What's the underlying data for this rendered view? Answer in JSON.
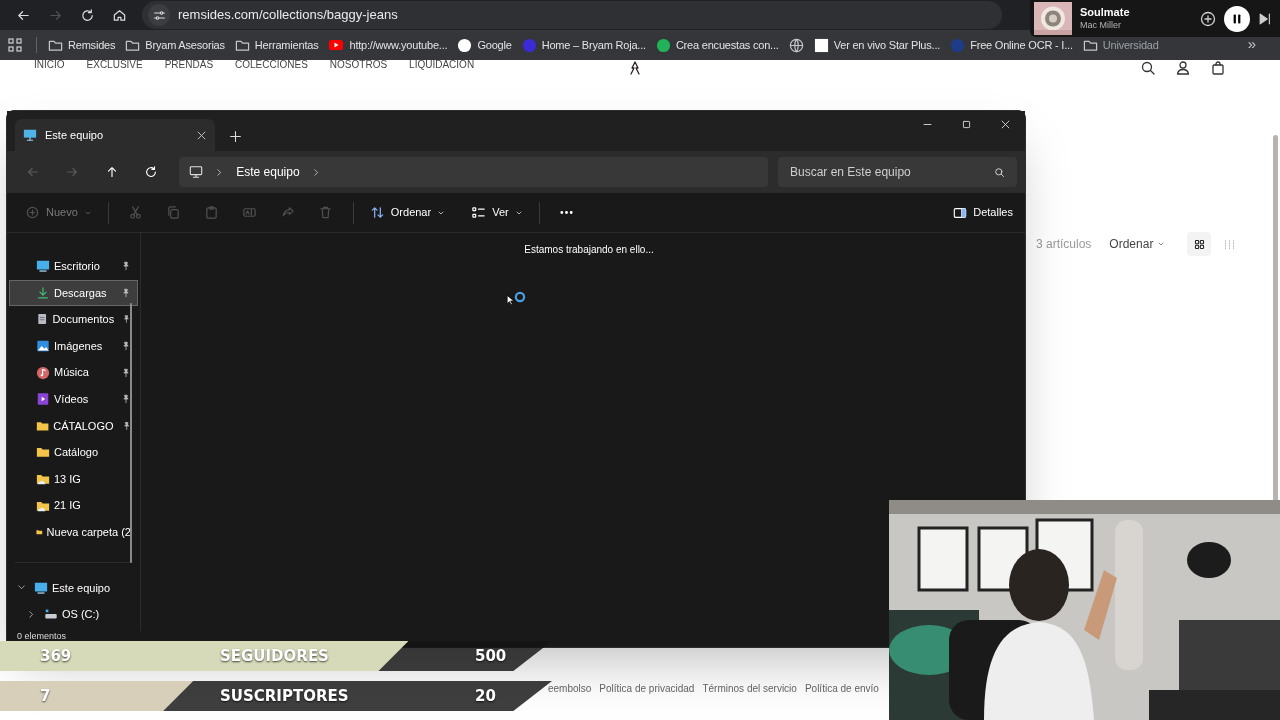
{
  "browser": {
    "address": "remsides.com/collections/baggy-jeans",
    "nav_buttons": [
      {
        "kind": "back",
        "disabled": false
      },
      {
        "kind": "forward",
        "disabled": true
      },
      {
        "kind": "reload",
        "disabled": false
      },
      {
        "kind": "home",
        "disabled": false
      }
    ],
    "bookmarks": [
      {
        "kind": "folder",
        "label": "Remsides"
      },
      {
        "kind": "folder",
        "label": "Bryam Asesorias"
      },
      {
        "kind": "folder",
        "label": "Herramientas"
      },
      {
        "kind": "video",
        "label": "http://www.youtube...",
        "color": "#ff0000"
      },
      {
        "kind": "site",
        "label": "Google",
        "color": "#ffffff"
      },
      {
        "kind": "site",
        "label": "Home – Bryam Roja...",
        "color": "#3b2bd6"
      },
      {
        "kind": "site",
        "label": "Crea encuestas con...",
        "color": "#22b35a"
      },
      {
        "kind": "globe"
      },
      {
        "kind": "page",
        "label": "Ver en vivo Star Plus..."
      },
      {
        "kind": "site",
        "label": "Free Online OCR - I...",
        "color": "#1f3c88"
      },
      {
        "kind": "folder",
        "label": "Universidad"
      }
    ],
    "more": "»"
  },
  "now_playing": {
    "title": "Soulmate",
    "artist": "Mac Miller",
    "playing": true
  },
  "website": {
    "nav": [
      "INICIO",
      "EXCLUSIVE",
      "PRENDAS",
      "COLECCIONES",
      "NOSOTROS",
      "LIQUIDACION"
    ],
    "product_count": "3 artículos",
    "sort": "Ordenar",
    "layouts": [
      {
        "kind": "large",
        "selected": true
      },
      {
        "kind": "small",
        "selected": false
      }
    ],
    "footer_links": [
      "eembolso",
      "Política de privacidad",
      "Términos del servicio",
      "Política de envío"
    ]
  },
  "explorer": {
    "tab": "Este equipo",
    "breadcrumb": "Este equipo",
    "search_placeholder": "Buscar en Este equipo",
    "nav_buttons": [
      {
        "kind": "back",
        "disabled": true
      },
      {
        "kind": "forward",
        "disabled": true
      },
      {
        "kind": "up",
        "disabled": false
      },
      {
        "kind": "refresh",
        "disabled": false
      }
    ],
    "toolbar": [
      {
        "kind": "new",
        "label": "Nuevo",
        "disabled": true
      },
      {
        "kind": "cut",
        "disabled": true
      },
      {
        "kind": "copy",
        "disabled": true
      },
      {
        "kind": "paste",
        "disabled": true
      },
      {
        "kind": "rename",
        "disabled": true
      },
      {
        "kind": "share",
        "disabled": true
      },
      {
        "kind": "delete",
        "disabled": true
      },
      {
        "kind": "sort",
        "label": "Ordenar",
        "disabled": false
      },
      {
        "kind": "view",
        "label": "Ver",
        "disabled": false
      },
      {
        "kind": "more",
        "disabled": false
      }
    ],
    "details": "Detalles",
    "quick_access": [
      {
        "label": "Escritorio",
        "kind": "desktop",
        "pinned": true,
        "selected": false
      },
      {
        "label": "Descargas",
        "kind": "download",
        "pinned": true,
        "selected": true
      },
      {
        "label": "Documentos",
        "kind": "document",
        "pinned": true,
        "selected": false
      },
      {
        "label": "Imágenes",
        "kind": "pictures",
        "pinned": true,
        "selected": false
      },
      {
        "label": "Música",
        "kind": "music",
        "pinned": true,
        "selected": false
      },
      {
        "label": "Vídeos",
        "kind": "video",
        "pinned": true,
        "selected": false
      },
      {
        "label": "CÁTALOGO",
        "kind": "folder",
        "pinned": true,
        "selected": false
      },
      {
        "label": "Catálogo",
        "kind": "folder",
        "pinned": false,
        "selected": false
      },
      {
        "label": "13 IG",
        "kind": "cloud_folder",
        "pinned": false,
        "selected": false
      },
      {
        "label": "21 IG",
        "kind": "cloud_folder",
        "pinned": false,
        "selected": false
      },
      {
        "label": "Nueva carpeta (2",
        "kind": "folder",
        "pinned": false,
        "selected": false
      }
    ],
    "tree": [
      {
        "label": "Este equipo",
        "kind": "desktop",
        "expanded": true,
        "children": [
          {
            "label": "OS (C:)",
            "kind": "drive",
            "expanded": false
          }
        ]
      }
    ],
    "message": "Estamos trabajando en ello...",
    "status": "0 elementos"
  },
  "stream_stats": [
    {
      "value": "369",
      "label": "SEGUIDORES",
      "goal": "500",
      "level": 0.74,
      "color": "#d6dab8"
    },
    {
      "value": "7",
      "label": "SUSCRIPTORES",
      "goal": "20",
      "level": 0.35,
      "color": "#d8cfbb"
    }
  ]
}
